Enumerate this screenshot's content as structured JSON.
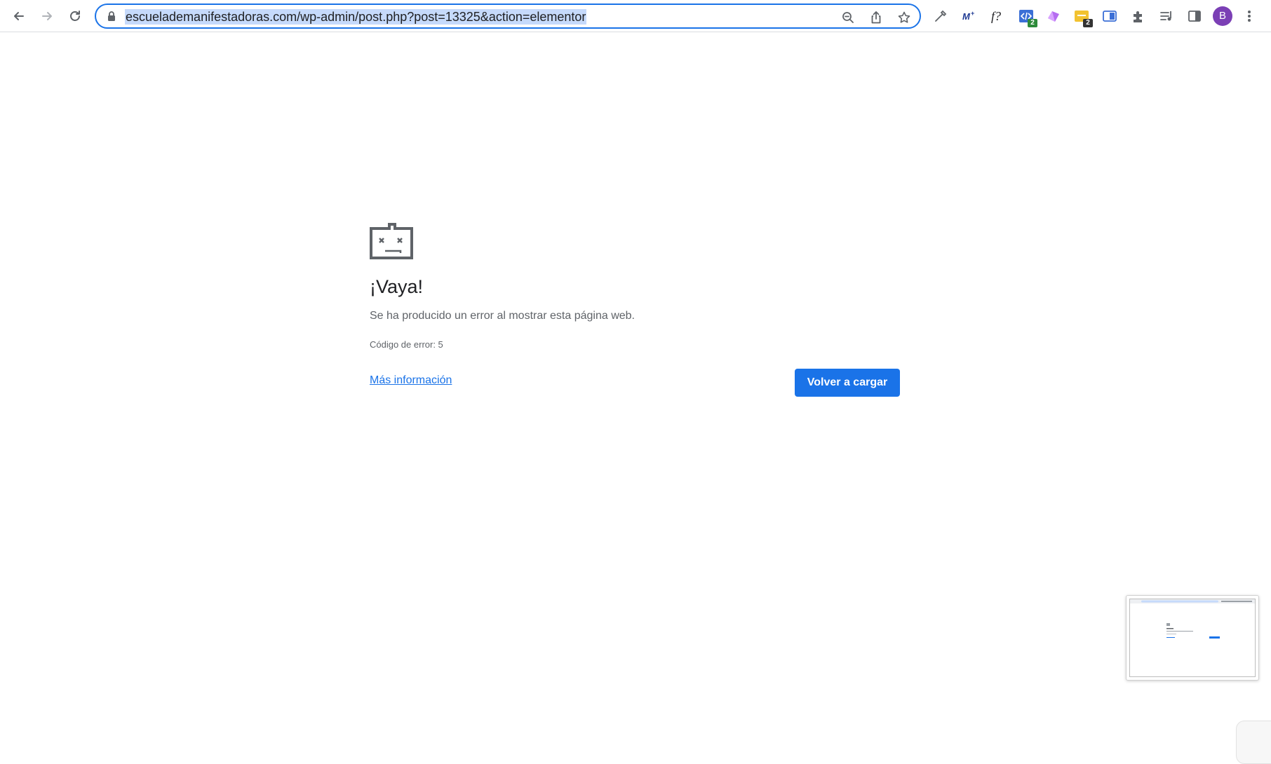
{
  "browser": {
    "url": "escuelademanifestadoras.com/wp-admin/post.php?post=13325&action=elementor",
    "nav": {
      "back_icon": "back-arrow-icon",
      "forward_icon": "forward-arrow-icon",
      "reload_icon": "reload-icon"
    },
    "omnibox_icons": [
      "lock-icon",
      "zoom-icon",
      "share-icon",
      "bookmark-star-icon"
    ],
    "extensions": [
      {
        "icon": "eyedropper-icon"
      },
      {
        "icon": "m-plus-icon",
        "label": "M+"
      },
      {
        "icon": "function-icon",
        "label": "f?"
      },
      {
        "icon": "code-icon",
        "badge": "2"
      },
      {
        "icon": "purple-gem-icon"
      },
      {
        "icon": "yellow-tag-icon",
        "badge": "2"
      },
      {
        "icon": "blue-panel-icon"
      },
      {
        "icon": "puzzle-icon"
      },
      {
        "icon": "media-queue-icon"
      },
      {
        "icon": "side-panel-icon"
      }
    ],
    "profile_initial": "B",
    "menu_icon": "kebab-menu-icon"
  },
  "error_page": {
    "icon": "sad-folder-icon",
    "title": "¡Vaya!",
    "message": "Se ha producido un error al mostrar esta página web.",
    "error_code": "Código de error: 5",
    "more_info_link": "Más información",
    "reload_button": "Volver a cargar"
  },
  "colors": {
    "accent": "#1a73e8",
    "url_selection": "#c6dafb",
    "avatar": "#7b3fb5"
  }
}
